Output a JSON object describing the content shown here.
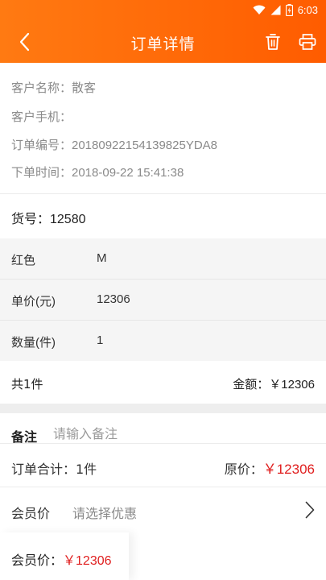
{
  "status_bar": {
    "time": "6:03",
    "icons": [
      "wifi-icon",
      "cell-signal-icon",
      "battery-icon"
    ]
  },
  "header": {
    "title": "订单详情",
    "icons": [
      "back-arrow-icon",
      "trash-icon",
      "printer-icon"
    ]
  },
  "order_info": {
    "customer_name": "客户名称：散客",
    "customer_phone": "客户手机：",
    "order_no": "订单编号：20180922154139825YDA8",
    "order_time": "下单时间：2018-09-22 15:41:38"
  },
  "goods": {
    "goods_no": "货号：12580"
  },
  "details": [
    {
      "key": "红色",
      "value": "M"
    },
    {
      "key": "单价(元)",
      "value": "12306"
    },
    {
      "key": "数量(件)",
      "value": "1"
    }
  ],
  "totals": {
    "count": "共1件",
    "amount": "金额：￥12306"
  },
  "remark": {
    "label": "备注",
    "placeholder": "请输入备注"
  },
  "summary": {
    "order_total": "订单合计：1件",
    "original_label": "原价：",
    "original_price": "￥12306"
  },
  "member": {
    "label": "会员价",
    "select_placeholder": "请选择优惠"
  },
  "bottom": {
    "label": "会员价：",
    "price": "￥12306"
  },
  "colors": {
    "header_start": "#ff7a12",
    "header_end": "#ff5c00",
    "price_red": "#e02020"
  }
}
